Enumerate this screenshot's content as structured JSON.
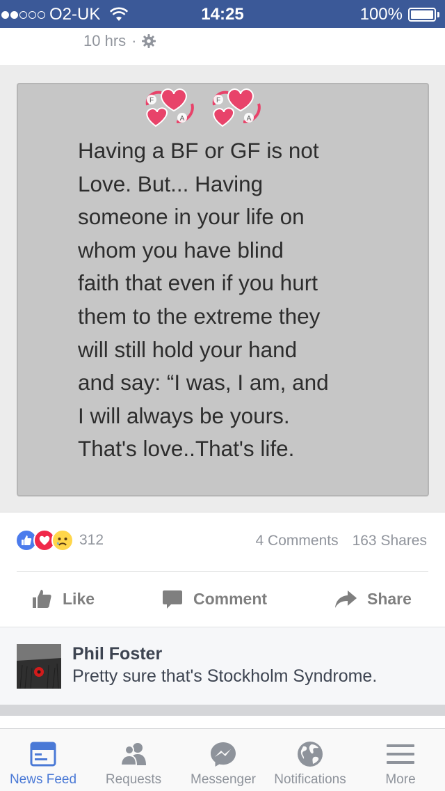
{
  "status_bar": {
    "signal_full": 2,
    "signal_empty": 3,
    "carrier": "O2-UK",
    "time": "14:25",
    "battery": "100%",
    "battery_level": 1.0
  },
  "post": {
    "time_ago": "10 hrs",
    "separator": "·",
    "privacy_icon": "gear-icon",
    "image": {
      "heart_letters": [
        "F",
        "A"
      ],
      "quote": "Having a BF or GF is not\nLove. But... Having\nsomeone in your life on\nwhom you have blind\nfaith that even if you hurt\nthem to the extreme they\nwill still hold your hand\nand say: “I was, I am, and\nI will always be yours.\nThat's love..That's life."
    },
    "reactions": {
      "icons": [
        "like-icon",
        "love-icon",
        "sad-icon"
      ],
      "count": "312"
    },
    "comments_count": "4 Comments",
    "shares_count": "163 Shares",
    "actions": {
      "like": "Like",
      "comment": "Comment",
      "share": "Share"
    }
  },
  "comment": {
    "author": "Phil Foster",
    "text": "Pretty sure that's Stockholm Syndrome."
  },
  "tab_bar": {
    "tabs": [
      {
        "label": "News Feed",
        "icon": "news-feed-icon",
        "active": true
      },
      {
        "label": "Requests",
        "icon": "requests-icon",
        "active": false
      },
      {
        "label": "Messenger",
        "icon": "messenger-icon",
        "active": false
      },
      {
        "label": "Notifications",
        "icon": "globe-icon",
        "active": false
      },
      {
        "label": "More",
        "icon": "menu-icon",
        "active": false
      }
    ]
  },
  "colors": {
    "brand_blue": "#3b5998",
    "active_tab": "#4a79d6",
    "inactive_tab": "#8e939b",
    "heart_pink": "#e8436a"
  }
}
